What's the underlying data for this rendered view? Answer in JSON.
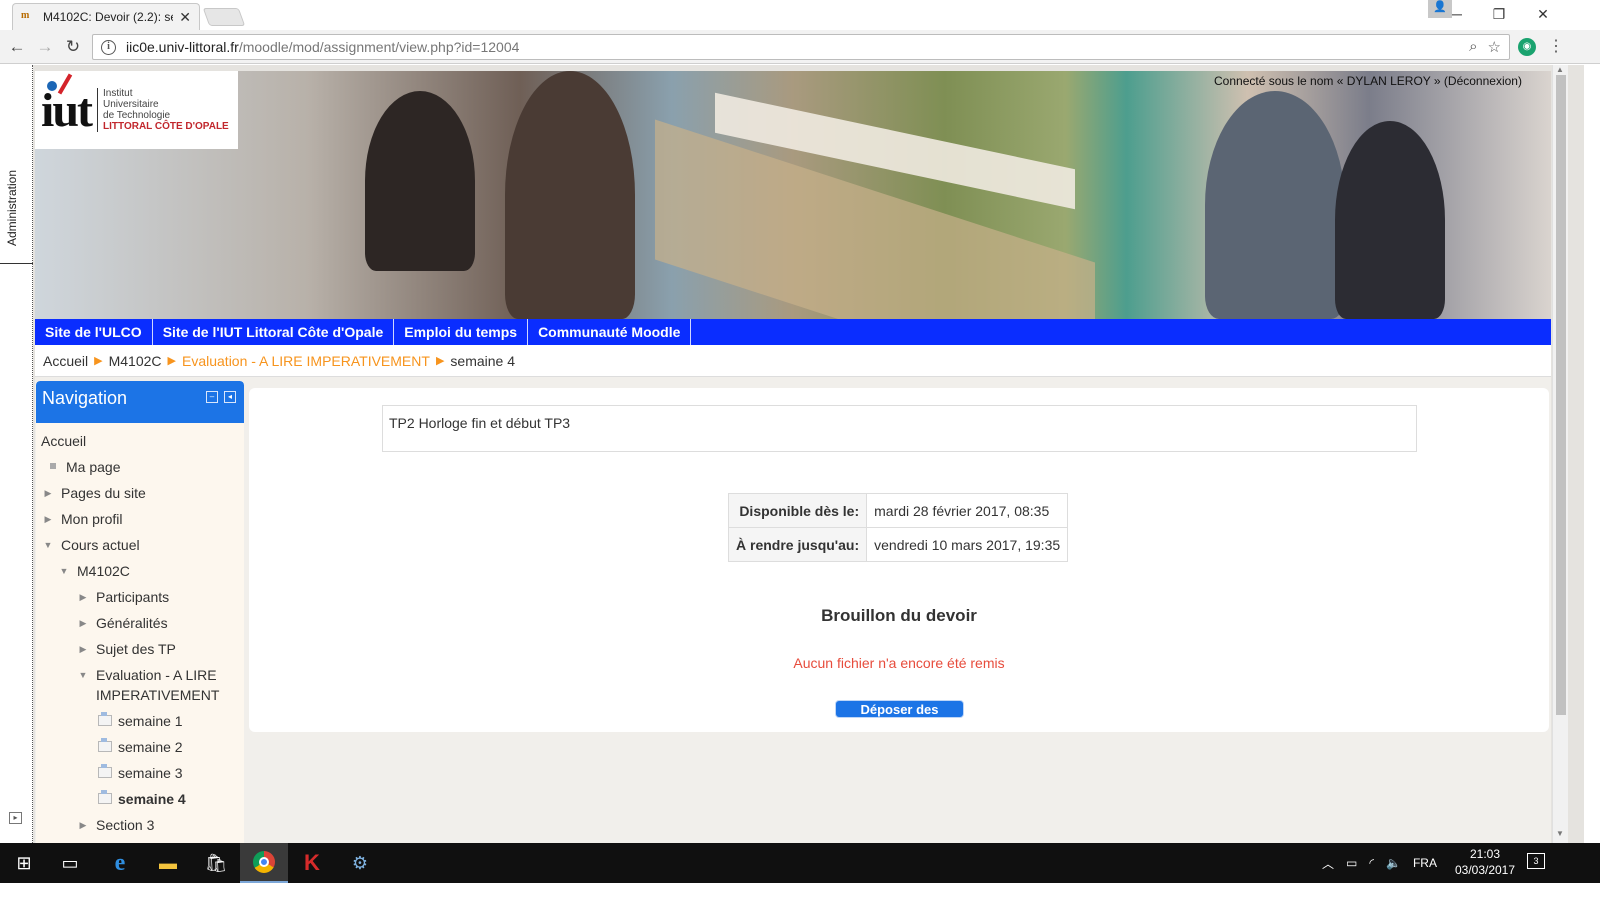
{
  "browser": {
    "tab_title": "M4102C: Devoir (2.2): se",
    "url_host": "iic0e.univ-littoral.fr",
    "url_path": "/moodle/mod/assignment/view.php?id=12004"
  },
  "admin": {
    "label": "Administration"
  },
  "logo": {
    "mark": "iut",
    "line1": "Institut",
    "line2": "Universitaire",
    "line3": "de Technologie",
    "line4": "LITTORAL CÔTE D'OPALE"
  },
  "user": {
    "prefix": "Connecté sous le nom « ",
    "name": "DYLAN LEROY",
    "suffix": " » (",
    "logout": "Déconnexion",
    "close": ")"
  },
  "custommenu": [
    "Site de l'ULCO",
    "Site de l'IUT Littoral Côte d'Opale",
    "Emploi du temps",
    "Communauté Moodle"
  ],
  "breadcrumb": {
    "home": "Accueil",
    "course": "M4102C",
    "section": "Evaluation - A LIRE IMPERATIVEMENT",
    "current": "semaine 4"
  },
  "navigation": {
    "title": "Navigation",
    "home": "Accueil",
    "my_page": "Ma page",
    "site_pages": "Pages du site",
    "my_profile": "Mon profil",
    "current_course": "Cours actuel",
    "course": "M4102C",
    "participants": "Participants",
    "generalites": "Généralités",
    "sujet": "Sujet des TP",
    "evaluation": "Evaluation - A LIRE IMPERATIVEMENT",
    "weeks": [
      "semaine 1",
      "semaine 2",
      "semaine 3",
      "semaine 4"
    ],
    "section3": "Section 3"
  },
  "assignment": {
    "intro": "TP2 Horloge fin et début TP3",
    "available_label": "Disponible dès le:",
    "available_value": "mardi 28 février 2017, 08:35",
    "due_label": "À rendre jusqu'au:",
    "due_value": "vendredi 10 mars 2017, 19:35",
    "draft_title": "Brouillon du devoir",
    "no_files": "Aucun fichier n'a encore été remis",
    "upload_button": "Déposer des fichiers"
  },
  "taskbar": {
    "lang": "FRA",
    "time": "21:03",
    "date": "03/03/2017",
    "notif_count": "3"
  },
  "colors": {
    "menu_blue": "#0a2dff",
    "nav_header": "#1c74e6",
    "breadcrumb_orange": "#f7941d",
    "error_red": "#e74c3c"
  }
}
